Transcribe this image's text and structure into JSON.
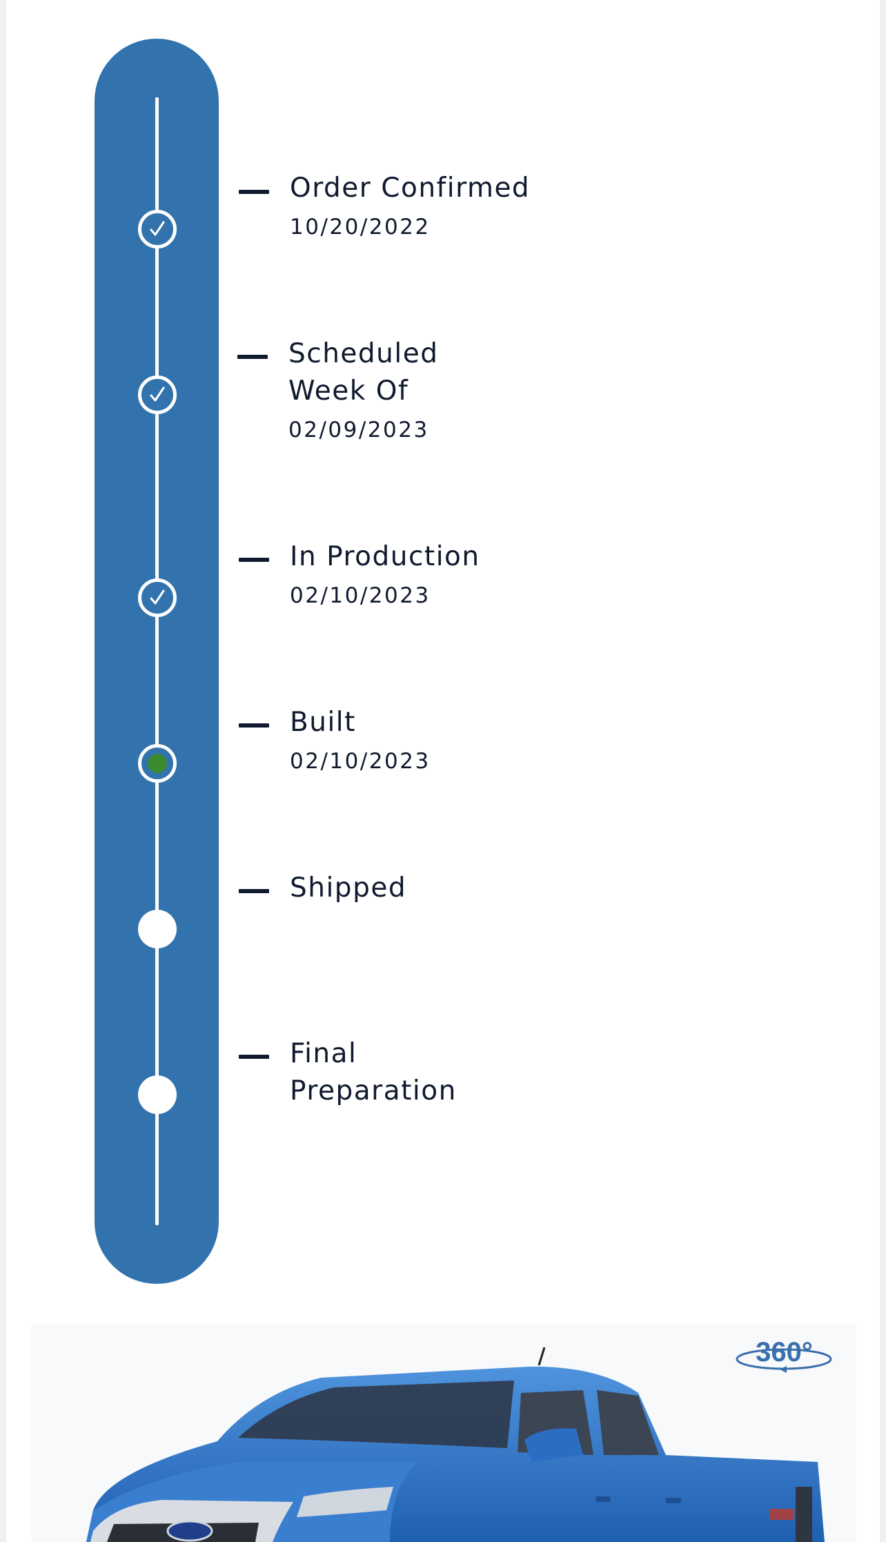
{
  "order_tracker": {
    "steps": [
      {
        "title": "Order Confirmed",
        "date": "10/20/2022",
        "status": "complete",
        "icon": "checkmark-icon"
      },
      {
        "title": "Scheduled Week Of",
        "date": "02/09/2023",
        "status": "complete",
        "icon": "checkmark-icon"
      },
      {
        "title": "In Production",
        "date": "02/10/2023",
        "status": "complete",
        "icon": "checkmark-icon"
      },
      {
        "title": "Built",
        "date": "02/10/2023",
        "status": "current",
        "icon": "current-dot-icon"
      },
      {
        "title": "Shipped",
        "date": "",
        "status": "pending",
        "icon": ""
      },
      {
        "title": "Final Preparation",
        "date": "",
        "status": "pending",
        "icon": ""
      }
    ],
    "colors": {
      "bar": "#3273ad",
      "current": "#3a8a2f",
      "text": "#101a2e"
    }
  },
  "vehicle_view": {
    "badge": "360°",
    "badge_icon": "rotate-360-icon",
    "image_alt": "vehicle-image"
  }
}
